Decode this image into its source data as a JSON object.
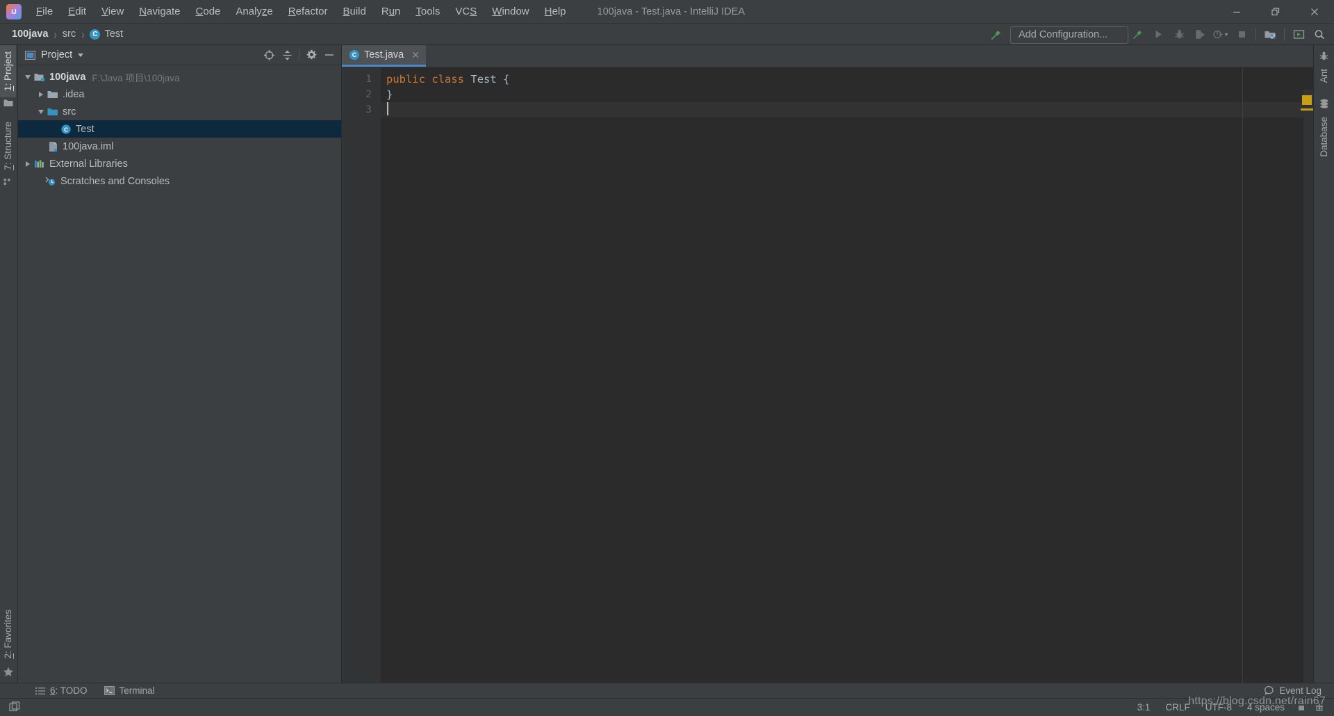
{
  "window": {
    "title": "100java - Test.java - IntelliJ IDEA",
    "logo_icon": "intellij-idea-logo",
    "controls": [
      {
        "name": "minimize-button",
        "icon": "minimize-icon"
      },
      {
        "name": "restore-button",
        "icon": "restore-icon"
      },
      {
        "name": "close-button",
        "icon": "close-icon"
      }
    ]
  },
  "menubar": {
    "items": [
      {
        "label": "File",
        "mnemonic": "F"
      },
      {
        "label": "Edit",
        "mnemonic": "E"
      },
      {
        "label": "View",
        "mnemonic": "V"
      },
      {
        "label": "Navigate",
        "mnemonic": "N"
      },
      {
        "label": "Code",
        "mnemonic": "C"
      },
      {
        "label": "Analyze",
        "mnemonic": "y"
      },
      {
        "label": "Refactor",
        "mnemonic": "R"
      },
      {
        "label": "Build",
        "mnemonic": "B"
      },
      {
        "label": "Run",
        "mnemonic": "u"
      },
      {
        "label": "Tools",
        "mnemonic": "T"
      },
      {
        "label": "VCS",
        "mnemonic": "S"
      },
      {
        "label": "Window",
        "mnemonic": "W"
      },
      {
        "label": "Help",
        "mnemonic": "H"
      }
    ]
  },
  "navbar": {
    "breadcrumbs": [
      {
        "label": "100java",
        "bold": true,
        "icon": null
      },
      {
        "label": "src",
        "bold": false,
        "icon": null
      },
      {
        "label": "Test",
        "bold": false,
        "icon": "class-icon",
        "badge": "C"
      }
    ],
    "separator": "›",
    "run_configuration": "Add Configuration...",
    "toolbar_icons": [
      {
        "name": "build-hammer-icon",
        "label": "Build",
        "color": "#499c54"
      },
      {
        "name": "run-icon",
        "label": "Run"
      },
      {
        "name": "debug-icon",
        "label": "Debug"
      },
      {
        "name": "run-with-coverage-icon",
        "label": "Run with Coverage"
      },
      {
        "name": "profile-icon",
        "label": "Profile"
      },
      {
        "name": "stop-icon",
        "label": "Stop"
      },
      {
        "name": "project-structure-icon",
        "label": "Project Structure"
      },
      {
        "name": "updates-icon",
        "label": "Updates"
      },
      {
        "name": "search-everywhere-icon",
        "label": "Search Everywhere"
      }
    ]
  },
  "left_strip": {
    "top_tabs": [
      {
        "label": "1: Project",
        "mnemonic": "1",
        "icon": "project-folder-icon",
        "active": true
      },
      {
        "label": "7: Structure",
        "mnemonic": "7",
        "icon": "structure-icon",
        "active": false
      }
    ],
    "bottom_tabs": [
      {
        "label": "2: Favorites",
        "mnemonic": "2",
        "icon": "star-icon",
        "active": false
      }
    ]
  },
  "right_strip": {
    "tabs": [
      {
        "label": "Ant",
        "icon": "ant-bug-icon"
      },
      {
        "label": "Database",
        "icon": "database-icon"
      }
    ]
  },
  "project_panel": {
    "title": "Project",
    "title_icon": "project-view-icon",
    "dropdown_icon": "chevron-down-icon",
    "actions": [
      {
        "name": "select-opened-file-icon",
        "label": "Select Opened File"
      },
      {
        "name": "collapse-all-icon",
        "label": "Collapse All"
      },
      {
        "name": "settings-gear-icon",
        "label": "Settings"
      },
      {
        "name": "hide-icon",
        "label": "Hide"
      }
    ],
    "tree": [
      {
        "label": "100java",
        "sub": "F:\\Java 项目\\100java",
        "indent": 0,
        "twisty": "down",
        "icon": "module-icon",
        "bold": true,
        "selected": false
      },
      {
        "label": ".idea",
        "sub": "",
        "indent": 1,
        "twisty": "right",
        "icon": "folder-icon",
        "bold": false,
        "selected": false
      },
      {
        "label": "src",
        "sub": "",
        "indent": 1,
        "twisty": "down",
        "icon": "source-folder-icon",
        "bold": false,
        "selected": false
      },
      {
        "label": "Test",
        "sub": "",
        "indent": 2,
        "twisty": "none",
        "icon": "class-icon",
        "bold": false,
        "selected": true
      },
      {
        "label": "100java.iml",
        "sub": "",
        "indent": 1,
        "twisty": "none",
        "icon": "iml-file-icon",
        "bold": false,
        "selected": false
      },
      {
        "label": "External Libraries",
        "sub": "",
        "indent": 0,
        "twisty": "right",
        "icon": "libraries-icon",
        "bold": false,
        "selected": false
      },
      {
        "label": "Scratches and Consoles",
        "sub": "",
        "indent": 0,
        "twisty": "none",
        "icon": "scratches-icon",
        "bold": false,
        "selected": false
      }
    ]
  },
  "editor": {
    "tabs": [
      {
        "label": "Test.java",
        "badge": "C",
        "icon": "java-class-icon",
        "active": true,
        "close_icon": "close-icon"
      }
    ],
    "line_numbers": [
      "1",
      "2",
      "3"
    ],
    "lines": [
      {
        "number": "1",
        "current": false,
        "tokens": [
          {
            "text": "public",
            "type": "keyword"
          },
          {
            "text": " ",
            "type": "plain"
          },
          {
            "text": "class",
            "type": "keyword"
          },
          {
            "text": " ",
            "type": "plain"
          },
          {
            "text": "Test",
            "type": "identifier"
          },
          {
            "text": " {",
            "type": "plain"
          }
        ]
      },
      {
        "number": "2",
        "current": false,
        "tokens": [
          {
            "text": "}",
            "type": "plain"
          }
        ]
      },
      {
        "number": "3",
        "current": true,
        "tokens": [
          {
            "text": "",
            "type": "plain"
          }
        ]
      }
    ],
    "inspection_marker_color": "#c9a012"
  },
  "bottom_tabs": [
    {
      "label": "6: TODO",
      "mnemonic": "6",
      "icon": "todo-list-icon"
    },
    {
      "label": "Terminal",
      "mnemonic": "",
      "icon": "terminal-icon"
    }
  ],
  "event_log": {
    "label": "Event Log",
    "icon": "event-log-balloon-icon"
  },
  "statusbar": {
    "toggle_icon": "toggle-toolwindows-icon",
    "caret_position": "3:1",
    "line_separator": "CRLF",
    "encoding": "UTF-8",
    "indent": "4 spaces",
    "lock_icon": "read-only-lock-icon",
    "inspector_icon": "inspection-hector-icon"
  },
  "watermark": "https://blog.csdn.net/rain67",
  "colors": {
    "chrome": "#3c3f41",
    "editor_bg": "#2b2b2b",
    "gutter_bg": "#313335",
    "selection": "#0d293e",
    "accent_blue": "#4a88c7",
    "keyword_orange": "#cc7832",
    "text_default": "#a9b7c6",
    "class_badge": "#3592c4",
    "warning": "#c9a012",
    "build_green": "#499c54"
  }
}
